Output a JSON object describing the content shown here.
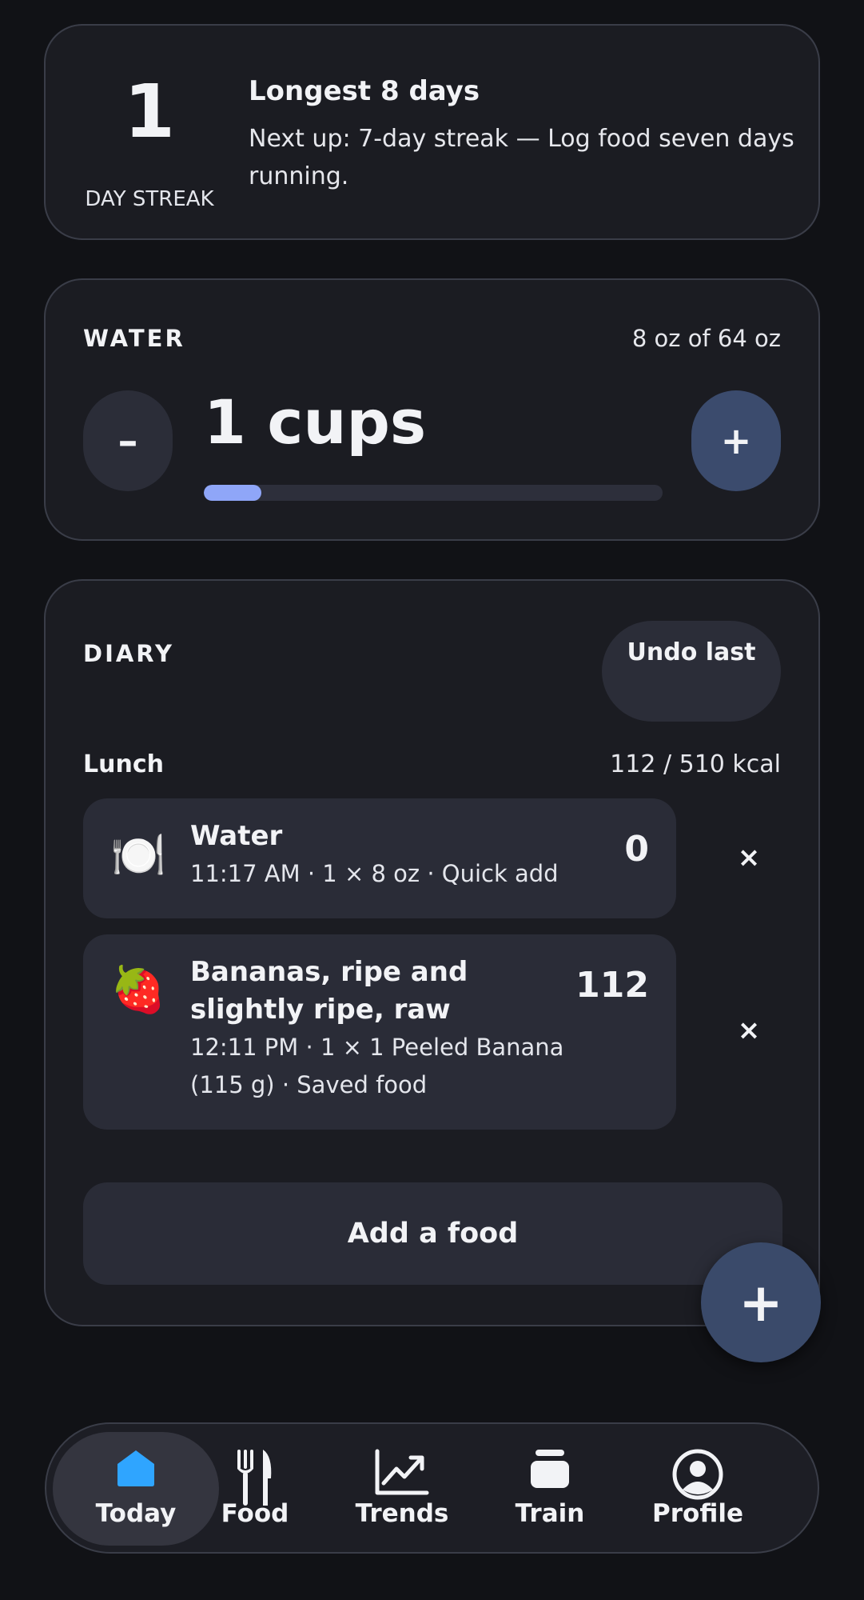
{
  "streak": {
    "count": "1",
    "label": "DAY STREAK",
    "longest": "Longest 8 days",
    "next": "Next up: 7-day streak — Log food seven days running."
  },
  "water": {
    "label": "WATER",
    "amount": "8 oz of 64 oz",
    "cups": "1 cups",
    "minus_label": "–",
    "plus_label": "+",
    "progress_fraction": 0.125,
    "progress_color": "#8fa6f8"
  },
  "diary": {
    "label": "DIARY",
    "undo_label": "Undo last",
    "meal": {
      "name": "Lunch",
      "kcal": "112 / 510 kcal"
    },
    "entries": [
      {
        "icon": "plate-icon",
        "glyph": "🍽️",
        "name": "Water",
        "detail": "11:17 AM · 1 × 8 oz · Quick add",
        "kcal": "0"
      },
      {
        "icon": "strawberry-icon",
        "glyph": "🍓",
        "name": "Bananas, ripe and slightly ripe, raw",
        "detail": "12:11 PM · 1 × 1 Peeled Banana (115 g) · Saved food",
        "kcal": "112"
      }
    ],
    "remove_glyph": "×",
    "add_food_label": "Add a food"
  },
  "fab": {
    "label": "+"
  },
  "nav": {
    "items": [
      {
        "label": "Today",
        "icon": "home-icon",
        "active": true
      },
      {
        "label": "Food",
        "icon": "fork-knife-icon"
      },
      {
        "label": "Trends",
        "icon": "trend-chart-icon"
      },
      {
        "label": "Train",
        "icon": "train-icon"
      },
      {
        "label": "Profile",
        "icon": "profile-icon"
      }
    ]
  },
  "colors": {
    "background": "#111216",
    "card": "#1b1c22",
    "accent_blue": "#3b4b6d",
    "home_icon": "#2fa5ff"
  }
}
